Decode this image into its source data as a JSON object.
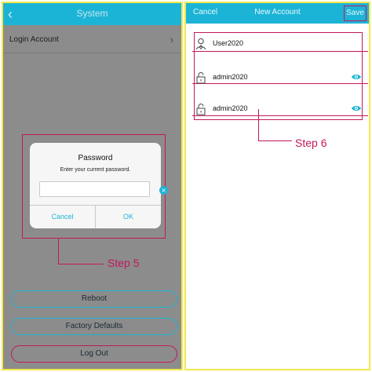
{
  "left": {
    "nav": {
      "title": "System",
      "back_icon": "chevron-left-icon"
    },
    "row": {
      "label": "Login Account",
      "chevron_icon": "chevron-right-icon"
    },
    "dialog": {
      "title": "Password",
      "subtitle": "Enter your current password.",
      "input_value": "",
      "clear_icon": "clear-circle-icon",
      "cancel_label": "Cancel",
      "ok_label": "OK"
    },
    "step_label": "Step 5",
    "buttons": {
      "reboot": "Reboot",
      "factory": "Factory Defaults",
      "logout": "Log Out"
    }
  },
  "right": {
    "nav": {
      "cancel_label": "Cancel",
      "title": "New Account",
      "save_label": "Save"
    },
    "fields": [
      {
        "value": "User2020",
        "icon": "user-icon"
      },
      {
        "value": "admin2020",
        "icon": "lock-icon",
        "toggle_icon": "eye-icon"
      },
      {
        "value": "admin2020",
        "icon": "lock-icon",
        "toggle_icon": "eye-icon"
      }
    ],
    "step_label": "Step 6"
  },
  "colors": {
    "accent": "#1cb4d6",
    "highlight": "#c2185b",
    "panel_border": "#f2e84a",
    "dim_overlay": "#8c8c8c"
  }
}
